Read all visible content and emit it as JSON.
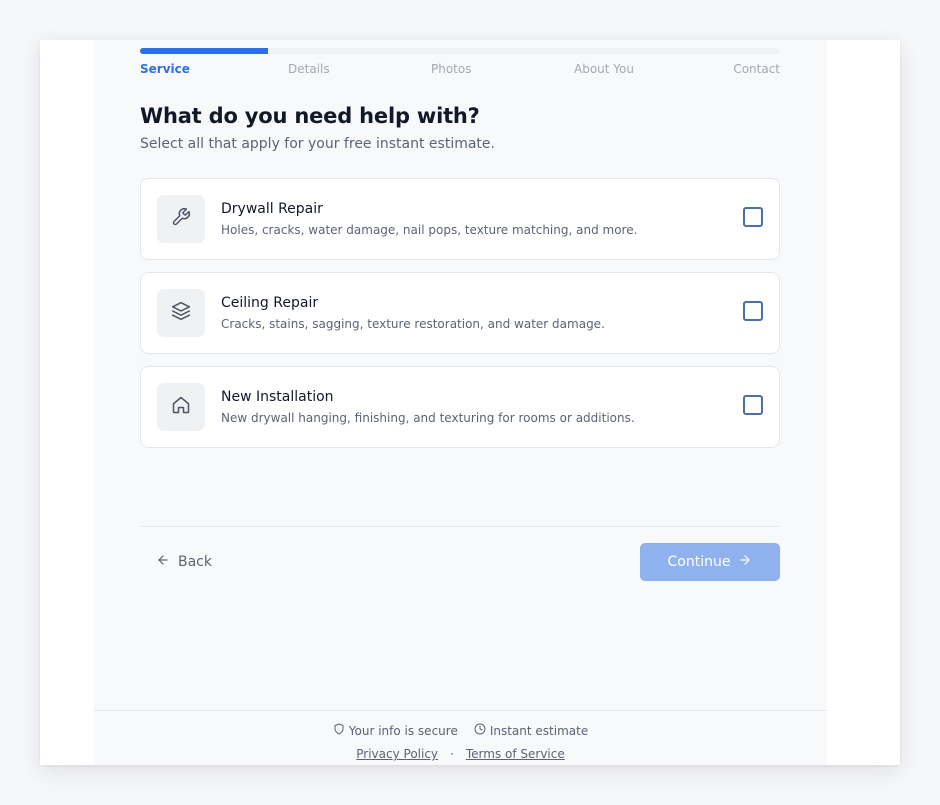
{
  "progress": {
    "steps": [
      "Service",
      "Details",
      "Photos",
      "About You",
      "Contact"
    ],
    "active_index": 0,
    "fraction_complete": 0.2
  },
  "heading": "What do you need help with?",
  "subheading": "Select all that apply for your free instant estimate.",
  "services": [
    {
      "title": "Drywall Repair",
      "description": "Holes, cracks, water damage, nail pops, texture matching, and more.",
      "icon": "wrench-icon",
      "checked": false
    },
    {
      "title": "Ceiling Repair",
      "description": "Cracks, stains, sagging, texture restoration, and water damage.",
      "icon": "layers-icon",
      "checked": false
    },
    {
      "title": "New Installation",
      "description": "New drywall hanging, finishing, and texturing for rooms or additions.",
      "icon": "home-icon",
      "checked": false
    }
  ],
  "nav": {
    "back_label": "Back",
    "continue_label": "Continue"
  },
  "footer": {
    "secure_text": "Your info is secure",
    "instant_text": "Instant estimate",
    "privacy_label": "Privacy Policy",
    "separator": "·",
    "terms_label": "Terms of Service"
  },
  "colors": {
    "accent": "#2f6fe4",
    "continue_disabled": "#8fb1ee",
    "checkbox_border": "#4b6fa8"
  }
}
